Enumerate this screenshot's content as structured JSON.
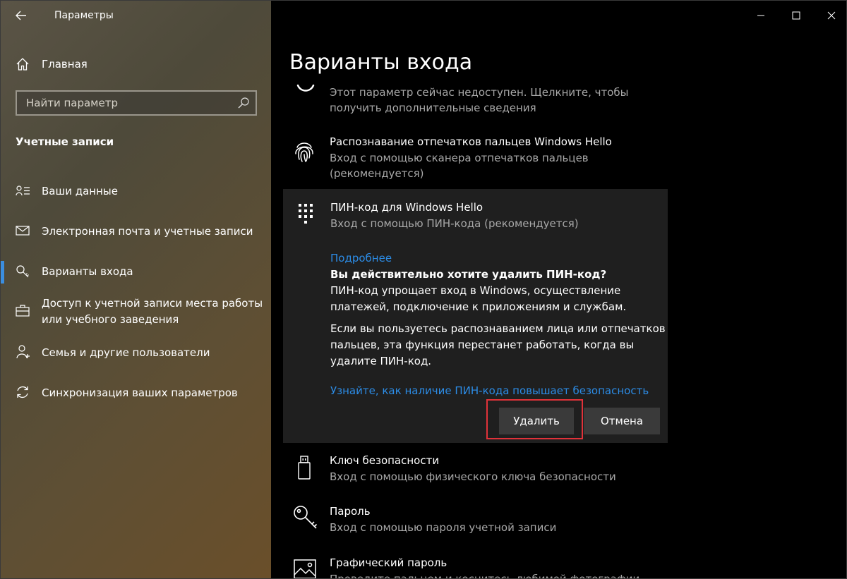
{
  "window": {
    "app_title": "Параметры",
    "page_title": "Варианты входа"
  },
  "sidebar": {
    "home_label": "Главная",
    "search_placeholder": "Найти параметр",
    "section_title": "Учетные записи",
    "items": [
      {
        "label": "Ваши данные",
        "icon": "person-card-icon"
      },
      {
        "label": "Электронная почта и учетные записи",
        "icon": "mail-icon"
      },
      {
        "label": "Варианты входа",
        "icon": "key-icon",
        "active": true
      },
      {
        "label": "Доступ к учетной записи места работы или учебного заведения",
        "icon": "briefcase-icon"
      },
      {
        "label": "Семья и другие пользователи",
        "icon": "person-add-icon"
      },
      {
        "label": "Синхронизация ваших параметров",
        "icon": "sync-icon"
      }
    ]
  },
  "options": {
    "face_subtitle": "Этот параметр сейчас недоступен. Щелкните, чтобы получить дополнительные сведения",
    "fingerprint": {
      "title": "Распознавание отпечатков пальцев Windows Hello",
      "subtitle": "Вход с помощью сканера отпечатков пальцев (рекомендуется)"
    },
    "pin": {
      "title": "ПИН-код для Windows Hello",
      "subtitle": "Вход с помощью ПИН-кода (рекомендуется)",
      "more_link": "Подробнее",
      "confirm_question": "Вы действительно хотите удалить ПИН-код?",
      "confirm_text1": "ПИН-код упрощает вход в Windows, осуществление платежей, подключение к приложениям и службам.",
      "confirm_text2": "Если вы пользуетесь распознаванием лица или отпечатков пальцев, эта функция перестанет работать, когда вы удалите ПИН-код.",
      "security_link": "Узнайте, как наличие ПИН-кода повышает безопасность",
      "delete_button": "Удалить",
      "cancel_button": "Отмена"
    },
    "security_key": {
      "title": "Ключ безопасности",
      "subtitle": "Вход с помощью физического ключа безопасности"
    },
    "password": {
      "title": "Пароль",
      "subtitle": "Вход с помощью пароля учетной записи"
    },
    "picture_password": {
      "title": "Графический пароль",
      "subtitle": "Проведите пальцем и коснитесь любимой фотографии"
    }
  },
  "colors": {
    "accent": "#2c8ce6",
    "active_marker": "#3b8ee0",
    "highlight": "#e0323a",
    "panel_bg": "#1f1f1f"
  }
}
